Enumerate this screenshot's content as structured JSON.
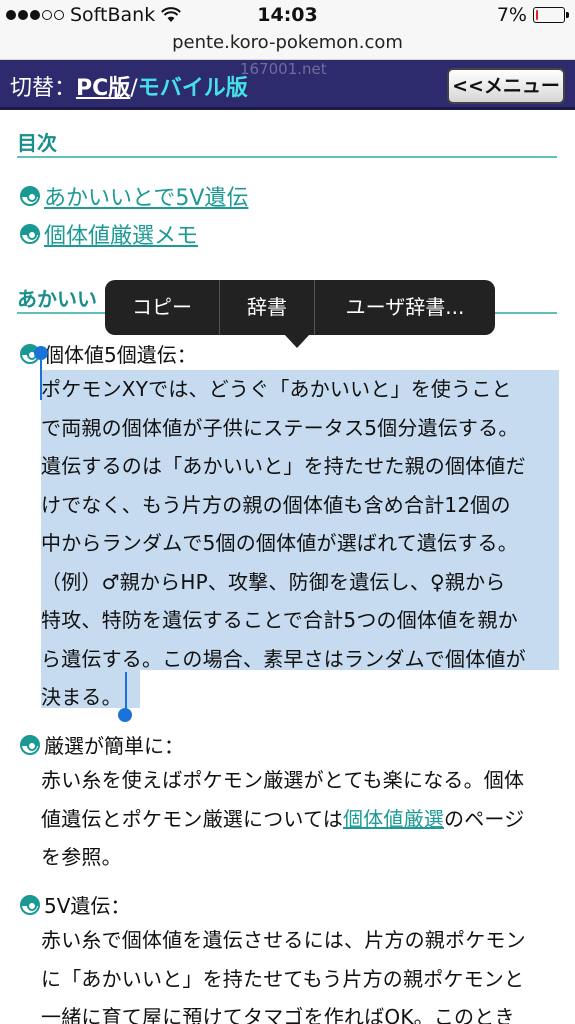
{
  "status": {
    "carrier": "SoftBank",
    "time": "14:03",
    "battery": "7%",
    "battery_level": 0.07
  },
  "url": "pente.koro-pokemon.com",
  "header": {
    "ghost_text": "167001.net",
    "switch_label": "切替：",
    "pc_label": "PC版",
    "slash": "/",
    "mobile_label": "モバイル版",
    "menu_button": "<<メニュー"
  },
  "toc": {
    "title": "目次",
    "links": [
      "あかいいとで5V遺伝",
      "個体値厳選メモ"
    ]
  },
  "section2": {
    "title_partial": "あかいい"
  },
  "popup": {
    "items": [
      "コピー",
      "辞書",
      "ユーザ辞書..."
    ]
  },
  "items": [
    {
      "heading": "個体値5個遺伝：",
      "lines": [
        "ポケモンXYでは、どうぐ「あかいいと」を使うこと",
        "で両親の個体値が子供にステータス5個分遺伝する。",
        "遺伝するのは「あかいいと」を持たせた親の個体値だ",
        "けでなく、もう片方の親の個体値も含め合計12個の",
        "中からランダムで5個の個体値が選ばれて遺伝する。",
        "（例）♂親からHP、攻撃、防御を遺伝し、♀親から",
        "特攻、特防を遺伝することで合計5つの個体値を親か",
        "ら遺伝する。この場合、素早さはランダムで個体値が",
        "決まる。"
      ]
    },
    {
      "heading": "厳選が簡単に：",
      "line1": "赤い糸を使えばポケモン厳選がとても楽になる。個体",
      "line2_pre": "値遺伝とポケモン厳選については",
      "line2_link": "個体値厳選",
      "line2_post": "のページ",
      "line3": "を参照。"
    },
    {
      "heading": "5V遺伝：",
      "lines": [
        "赤い糸で個体値を遺伝させるには、片方の親ポケモン",
        "に「あかいいと」を持たせてもう片方の親ポケモンと",
        "一緒に育て屋に預けてタマゴを作ればOK。このとき"
      ]
    }
  ]
}
